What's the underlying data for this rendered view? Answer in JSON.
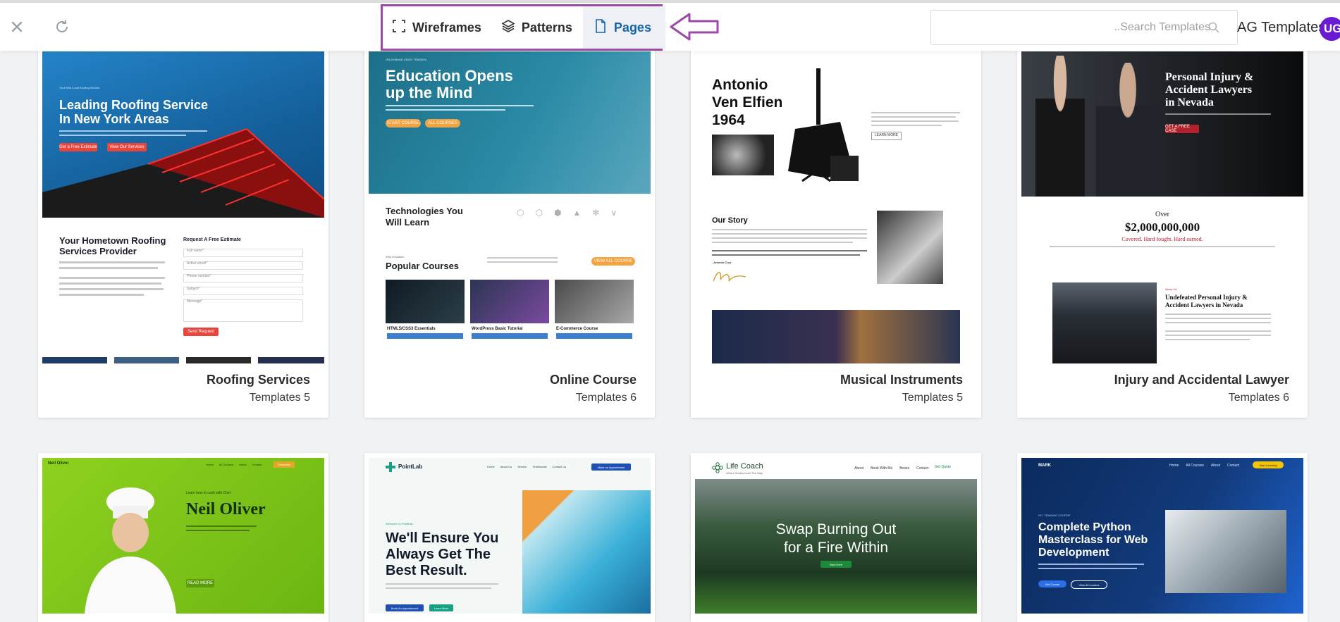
{
  "topbar": {
    "close_icon": "close-icon",
    "refresh_icon": "refresh-icon",
    "tabs": [
      {
        "label": "Wireframes",
        "icon": "wireframe-icon"
      },
      {
        "label": "Patterns",
        "icon": "layers-icon"
      },
      {
        "label": "Pages",
        "icon": "page-icon",
        "active": true
      }
    ],
    "search_placeholder": "..Search Templates",
    "ag_label": "AG Templates",
    "avatar": "UG",
    "highlight_color": "#9b4aa8",
    "active_color": "#1565a8"
  },
  "cards": [
    {
      "name": "Roofing Services",
      "count": "Templates 5",
      "thumb": {
        "kicker": "Your Best Local Roofing Service",
        "headline_1": "Leading Roofing Service",
        "headline_2": "In New York Areas",
        "cta_1": "Get a Free Estimate",
        "cta_2": "View Our Services",
        "section_1": "Your Hometown Roofing",
        "section_2": "Services Provider",
        "form_title": "Request A Free Estimate",
        "form_fields": [
          "Full name*",
          "Active email*",
          "Phone number*",
          "Subject*",
          "Message*"
        ],
        "form_button": "Send Request"
      }
    },
    {
      "name": "Online Course",
      "count": "Templates 6",
      "thumb": {
        "kicker": "ON-DEMAND VIDEO TRAINING",
        "headline_1": "Education Opens",
        "headline_2": "up the Mind",
        "cta_1": "START COURSE",
        "cta_2": "ALL COURSES",
        "tech_1": "Technologies You",
        "tech_2": "Will Learn",
        "courses_kicker": "Why education",
        "courses_title": "Popular Courses",
        "courses_button": "VIEW ALL COURSE",
        "courses": [
          "HTML5/CSS3 Essentials",
          "WordPress Basic Tutorial",
          "E-Commerce Course"
        ]
      }
    },
    {
      "name": "Musical Instruments",
      "count": "Templates 5",
      "thumb": {
        "headline_1": "Antonio",
        "headline_2": "Ven Elfien",
        "headline_3": "1964",
        "learn_more": "LEARN MORE",
        "story_title": "Our Story",
        "signature": "- Antonio Cruz"
      }
    },
    {
      "name": "Injury and Accidental Lawyer",
      "count": "Templates 6",
      "thumb": {
        "headline_1": "Personal Injury &",
        "headline_2": "Accident Lawyers",
        "headline_3": "in Nevada",
        "cta": "GET A FREE CASE",
        "over": "Over",
        "amount": "$2,000,000,000",
        "tagline": "Covered. Hard fought. Hard earned.",
        "about_kicker": "About Us",
        "about_1": "Undefeated Personal Injury &",
        "about_2": "Accident Lawyers in Nevada"
      }
    },
    {
      "thumb": {
        "brand": "Neil Oliver",
        "nav": [
          "Home",
          "All Courses",
          "About",
          "Contact"
        ],
        "nav_cta": "Subscribe",
        "kicker": "Learn how to cook with Chef",
        "headline": "Neil Oliver",
        "cta": "READ MORE"
      }
    },
    {
      "thumb": {
        "brand": "PointLab",
        "nav": [
          "Home",
          "About Us",
          "Service",
          "Testimonial",
          "Contact Us"
        ],
        "nav_cta": "Make an Appointment",
        "kicker": "Welcome To PointLab",
        "headline_1": "We'll Ensure You",
        "headline_2": "Always Get The",
        "headline_3": "Best Result.",
        "cta_1": "Book An Appointment",
        "cta_2": "Learn More"
      }
    },
    {
      "thumb": {
        "brand": "Life Coach",
        "brand_sub": "Where Smiles Lead The Way",
        "nav": [
          "About",
          "Book With Me",
          "Books",
          "Contact"
        ],
        "nav_cta": "Get Quote",
        "headline_1": "Swap Burning Out",
        "headline_2": "for a Fire Within",
        "cta": "Start Here"
      }
    },
    {
      "thumb": {
        "brand": "MARK",
        "nav": [
          "Home",
          "All Courses",
          "About",
          "Contact"
        ],
        "nav_cta": "Start Learning",
        "kicker": "NO. TRAINING COURSE",
        "headline_1": "Complete Python",
        "headline_2": "Masterclass for Web",
        "headline_3": "Development",
        "cta_1": "Get Course",
        "cta_2": "View All courses"
      }
    }
  ]
}
